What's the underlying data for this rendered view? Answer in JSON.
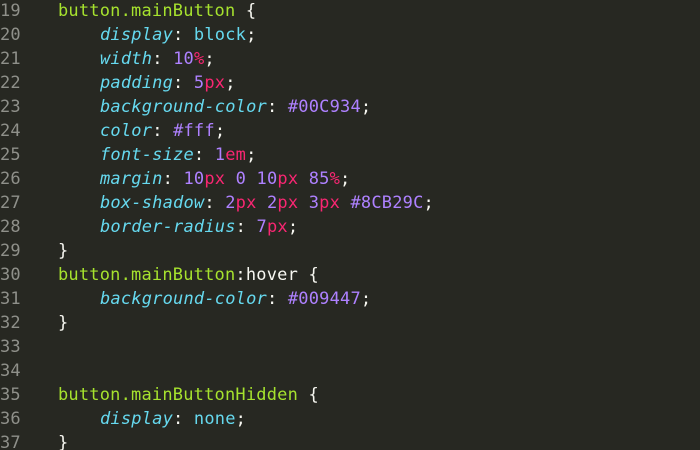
{
  "theme": {
    "background": "#272822",
    "gutter_text": "#8f908a",
    "tag": "#f92672",
    "selector_class": "#a6e22e",
    "property": "#66d9ef",
    "number": "#ae81ff",
    "unit": "#f92672",
    "plain": "#f8f8f2"
  },
  "lines": [
    {
      "n": "19",
      "indent": 0,
      "tokens": [
        {
          "t": "button",
          "c": "cls"
        },
        {
          "t": ".mainButton",
          "c": "cls"
        },
        {
          "t": " {",
          "c": "punc"
        }
      ]
    },
    {
      "n": "20",
      "indent": 1,
      "tokens": [
        {
          "t": "display",
          "c": "prop"
        },
        {
          "t": ": ",
          "c": "punc"
        },
        {
          "t": "block",
          "c": "kw"
        },
        {
          "t": ";",
          "c": "punc"
        }
      ]
    },
    {
      "n": "21",
      "indent": 1,
      "tokens": [
        {
          "t": "width",
          "c": "prop"
        },
        {
          "t": ": ",
          "c": "punc"
        },
        {
          "t": "10",
          "c": "num"
        },
        {
          "t": "%",
          "c": "unit"
        },
        {
          "t": ";",
          "c": "punc"
        }
      ]
    },
    {
      "n": "22",
      "indent": 1,
      "tokens": [
        {
          "t": "padding",
          "c": "prop"
        },
        {
          "t": ": ",
          "c": "punc"
        },
        {
          "t": "5",
          "c": "num"
        },
        {
          "t": "px",
          "c": "unit"
        },
        {
          "t": ";",
          "c": "punc"
        }
      ]
    },
    {
      "n": "23",
      "indent": 1,
      "tokens": [
        {
          "t": "background-color",
          "c": "prop"
        },
        {
          "t": ": ",
          "c": "punc"
        },
        {
          "t": "#00C934",
          "c": "num"
        },
        {
          "t": ";",
          "c": "punc"
        }
      ]
    },
    {
      "n": "24",
      "indent": 1,
      "tokens": [
        {
          "t": "color",
          "c": "prop"
        },
        {
          "t": ": ",
          "c": "punc"
        },
        {
          "t": "#fff",
          "c": "num"
        },
        {
          "t": ";",
          "c": "punc"
        }
      ]
    },
    {
      "n": "25",
      "indent": 1,
      "tokens": [
        {
          "t": "font-size",
          "c": "prop"
        },
        {
          "t": ": ",
          "c": "punc"
        },
        {
          "t": "1",
          "c": "num"
        },
        {
          "t": "em",
          "c": "unit"
        },
        {
          "t": ";",
          "c": "punc"
        }
      ]
    },
    {
      "n": "26",
      "indent": 1,
      "tokens": [
        {
          "t": "margin",
          "c": "prop"
        },
        {
          "t": ": ",
          "c": "punc"
        },
        {
          "t": "10",
          "c": "num"
        },
        {
          "t": "px",
          "c": "unit"
        },
        {
          "t": " ",
          "c": "punc"
        },
        {
          "t": "0",
          "c": "num"
        },
        {
          "t": " ",
          "c": "punc"
        },
        {
          "t": "10",
          "c": "num"
        },
        {
          "t": "px",
          "c": "unit"
        },
        {
          "t": " ",
          "c": "punc"
        },
        {
          "t": "85",
          "c": "num"
        },
        {
          "t": "%",
          "c": "unit"
        },
        {
          "t": ";",
          "c": "punc"
        }
      ]
    },
    {
      "n": "27",
      "indent": 1,
      "tokens": [
        {
          "t": "box-shadow",
          "c": "prop"
        },
        {
          "t": ": ",
          "c": "punc"
        },
        {
          "t": "2",
          "c": "num"
        },
        {
          "t": "px",
          "c": "unit"
        },
        {
          "t": " ",
          "c": "punc"
        },
        {
          "t": "2",
          "c": "num"
        },
        {
          "t": "px",
          "c": "unit"
        },
        {
          "t": " ",
          "c": "punc"
        },
        {
          "t": "3",
          "c": "num"
        },
        {
          "t": "px",
          "c": "unit"
        },
        {
          "t": " ",
          "c": "punc"
        },
        {
          "t": "#8CB29C",
          "c": "num"
        },
        {
          "t": ";",
          "c": "punc"
        }
      ]
    },
    {
      "n": "28",
      "indent": 1,
      "tokens": [
        {
          "t": "border-radius",
          "c": "prop"
        },
        {
          "t": ": ",
          "c": "punc"
        },
        {
          "t": "7",
          "c": "num"
        },
        {
          "t": "px",
          "c": "unit"
        },
        {
          "t": ";",
          "c": "punc"
        }
      ]
    },
    {
      "n": "29",
      "indent": 0,
      "tokens": [
        {
          "t": "}",
          "c": "punc"
        }
      ]
    },
    {
      "n": "30",
      "indent": 0,
      "tokens": [
        {
          "t": "button",
          "c": "cls"
        },
        {
          "t": ".mainButton",
          "c": "cls"
        },
        {
          "t": ":hover",
          "c": "punc"
        },
        {
          "t": " {",
          "c": "punc"
        }
      ]
    },
    {
      "n": "31",
      "indent": 1,
      "tokens": [
        {
          "t": "background-color",
          "c": "prop"
        },
        {
          "t": ": ",
          "c": "punc"
        },
        {
          "t": "#009447",
          "c": "num"
        },
        {
          "t": ";",
          "c": "punc"
        }
      ]
    },
    {
      "n": "32",
      "indent": 0,
      "tokens": [
        {
          "t": "}",
          "c": "punc"
        }
      ]
    },
    {
      "n": "33",
      "indent": 0,
      "tokens": []
    },
    {
      "n": "34",
      "indent": 0,
      "tokens": []
    },
    {
      "n": "35",
      "indent": 0,
      "tokens": [
        {
          "t": "button",
          "c": "cls"
        },
        {
          "t": ".mainButtonHidden",
          "c": "cls"
        },
        {
          "t": " {",
          "c": "punc"
        }
      ]
    },
    {
      "n": "36",
      "indent": 1,
      "tokens": [
        {
          "t": "display",
          "c": "prop"
        },
        {
          "t": ": ",
          "c": "punc"
        },
        {
          "t": "none",
          "c": "kw"
        },
        {
          "t": ";",
          "c": "punc"
        }
      ]
    },
    {
      "n": "37",
      "indent": 0,
      "tokens": [
        {
          "t": "}",
          "c": "punc"
        }
      ]
    }
  ]
}
